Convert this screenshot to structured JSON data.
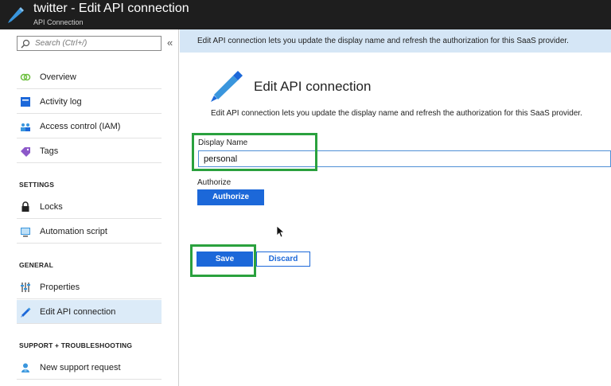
{
  "header": {
    "title": "twitter - Edit API connection",
    "subtitle": "API Connection"
  },
  "sidebar": {
    "search_placeholder": "Search (Ctrl+/)",
    "collapse_glyph": "«",
    "items": [
      {
        "label": "Overview",
        "icon": "overview-icon"
      },
      {
        "label": "Activity log",
        "icon": "activity-log-icon"
      },
      {
        "label": "Access control (IAM)",
        "icon": "iam-icon"
      },
      {
        "label": "Tags",
        "icon": "tag-icon"
      },
      {
        "label": "Locks",
        "icon": "lock-icon"
      },
      {
        "label": "Automation script",
        "icon": "automation-script-icon"
      },
      {
        "label": "Properties",
        "icon": "properties-icon"
      },
      {
        "label": "Edit API connection",
        "icon": "pencil-icon",
        "active": true
      },
      {
        "label": "New support request",
        "icon": "support-icon"
      }
    ],
    "sections": {
      "settings": "SETTINGS",
      "general": "GENERAL",
      "support": "SUPPORT + TROUBLESHOOTING"
    }
  },
  "main": {
    "banner": "Edit API connection lets you update the display name and refresh the authorization for this SaaS provider.",
    "title": "Edit API connection",
    "description": "Edit API connection lets you update the display name and refresh the authorization for this SaaS provider.",
    "display_name_label": "Display Name",
    "display_name_value": "personal",
    "authorize_label": "Authorize",
    "authorize_button": "Authorize",
    "save_button": "Save",
    "discard_button": "Discard"
  },
  "colors": {
    "accent": "#1c68d9",
    "highlight": "#2aa13e",
    "banner": "#d5e6f6",
    "header": "#1e1e1e"
  }
}
